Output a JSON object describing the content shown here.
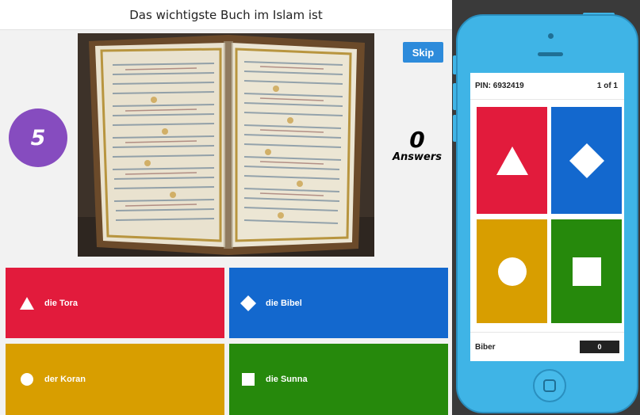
{
  "question": {
    "text": "Das wichtigste Buch im Islam ist"
  },
  "timer": {
    "value": "5"
  },
  "skip": {
    "label": "Skip"
  },
  "answers_counter": {
    "count": "0",
    "label": "Answers"
  },
  "answers": [
    {
      "label": "die Tora",
      "shape": "triangle-icon"
    },
    {
      "label": "die Bibel",
      "shape": "diamond-icon"
    },
    {
      "label": "der Koran",
      "shape": "circle-icon"
    },
    {
      "label": "die Sunna",
      "shape": "square-icon"
    }
  ],
  "phone": {
    "pin": "PIN: 6932419",
    "page": "1 of 1",
    "player": "Biber",
    "score": "0"
  },
  "colors": {
    "red": "#e21b3c",
    "blue": "#1368ce",
    "yellow": "#d89e00",
    "green": "#26890c",
    "purple": "#864cbf",
    "skip_blue": "#2d8bdb",
    "phone_body": "#3fb4e6"
  }
}
